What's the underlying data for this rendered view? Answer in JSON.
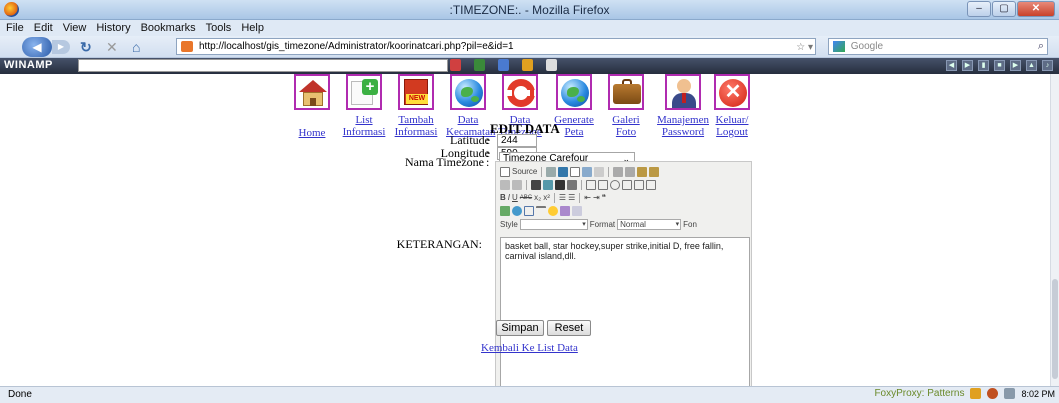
{
  "window": {
    "title": ":TIMEZONE:. - Mozilla Firefox",
    "minimize": "–",
    "maximize": "▢",
    "close": "✕"
  },
  "menubar": [
    "File",
    "Edit",
    "View",
    "History",
    "Bookmarks",
    "Tools",
    "Help"
  ],
  "navbar": {
    "url": "http://localhost/gis_timezone/Administrator/koorinatcari.php?pil=e&id=1",
    "search_placeholder": "Google",
    "back_icon": "back-arrow-icon",
    "reload_icon": "reload-icon",
    "stop_icon": "stop-icon",
    "home_icon": "home-icon"
  },
  "toolbar": {
    "brand": "WINAMP"
  },
  "menu_items": [
    {
      "label_line1": "Home",
      "label_line2": "",
      "icon": "house-icon"
    },
    {
      "label_line1": "List",
      "label_line2": "Informasi",
      "icon": "list-add-icon"
    },
    {
      "label_line1": "Tambah",
      "label_line2": "Informasi",
      "icon": "new-document-icon"
    },
    {
      "label_line1": "Data",
      "label_line2": "Kecamatan",
      "icon": "globe-icon"
    },
    {
      "label_line1": "Data",
      "label_line2": "Timezone",
      "icon": "lifebuoy-icon"
    },
    {
      "label_line1": "Generate",
      "label_line2": "Peta",
      "icon": "globe-icon"
    },
    {
      "label_line1": "Galeri",
      "label_line2": "Foto",
      "icon": "briefcase-icon"
    },
    {
      "label_line1": "Manajemen",
      "label_line2": "Password",
      "icon": "user-icon"
    },
    {
      "label_line1": "Keluar/",
      "label_line2": "Logout",
      "icon": "close-circle-icon"
    }
  ],
  "form": {
    "heading": "EDIT DATA",
    "latitude_label": "Latitude",
    "latitude_value": "244",
    "longitude_label": "Longitude",
    "longitude_value": "590",
    "timezone_label": "Nama Timezone",
    "timezone_value": "Timezone Carefour",
    "colon": ":",
    "keterangan_label": "KETERANGAN:",
    "keterangan_text": "basket ball, star hockey,super strike,initial D, free fallin, carnival island,dll.",
    "submit_label": "Simpan",
    "reset_label": "Reset",
    "back_link": "Kembali Ke List Data"
  },
  "editor": {
    "source_label": "Source",
    "style_label": "Style",
    "format_label": "Format",
    "format_value": "Normal",
    "font_label": "Fon",
    "bold": "B",
    "italic": "I",
    "underline": "U",
    "strike": "ABC"
  },
  "status": {
    "text": "Done",
    "foxyproxy": "FoxyProxy: Patterns",
    "clock": "8:02 PM"
  },
  "colors": {
    "menu_border": "#b02bb0",
    "link": "#3333cc"
  }
}
